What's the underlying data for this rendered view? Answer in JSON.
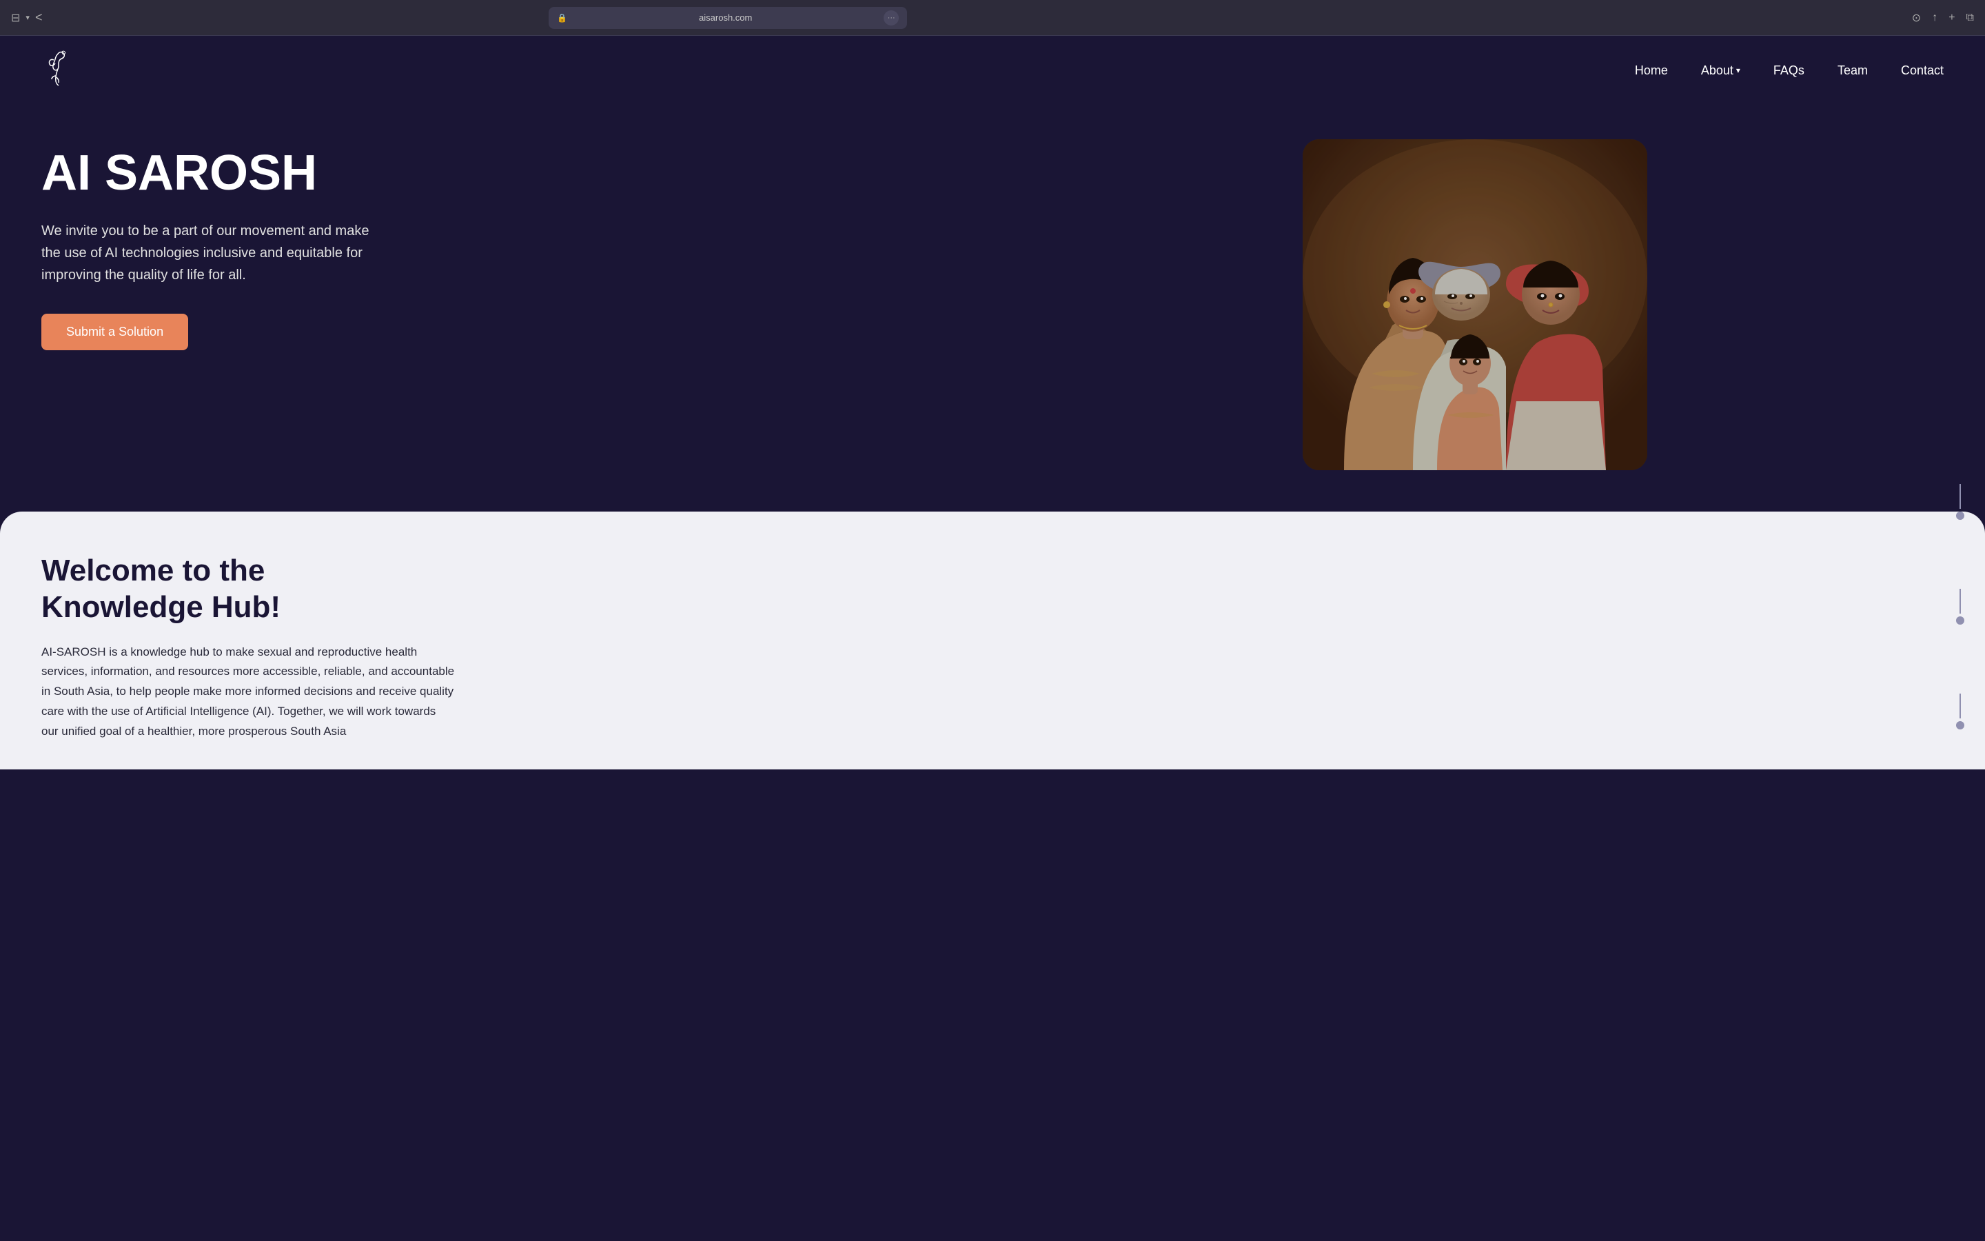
{
  "browser": {
    "url": "aisarosh.com",
    "lock_icon": "🔒",
    "dots": "···"
  },
  "navbar": {
    "logo_alt": "AI Sarosh Logo",
    "links": [
      {
        "label": "Home",
        "id": "home",
        "has_dropdown": false
      },
      {
        "label": "About",
        "id": "about",
        "has_dropdown": true
      },
      {
        "label": "FAQs",
        "id": "faqs",
        "has_dropdown": false
      },
      {
        "label": "Team",
        "id": "team",
        "has_dropdown": false
      },
      {
        "label": "Contact",
        "id": "contact",
        "has_dropdown": false
      }
    ]
  },
  "hero": {
    "title": "AI SAROSH",
    "subtitle": "We invite you to be a part of our movement and make the use of AI technologies inclusive and equitable for improving the quality of life for all.",
    "cta_button": "Submit a Solution",
    "image_alt": "Three generations of South Asian women with a child"
  },
  "knowledge_hub": {
    "title": "Welcome to the Knowledge Hub!",
    "description": "AI-SAROSH is a knowledge hub to make sexual and reproductive health services, information, and resources more accessible, reliable, and accountable in South Asia, to help people make more informed decisions and receive quality care with the use of Artificial Intelligence (AI). Together, we will work towards our unified goal of a healthier, more prosperous South Asia"
  },
  "colors": {
    "bg_dark": "#1a1535",
    "cta_orange": "#e8845a",
    "text_white": "#ffffff",
    "text_light": "#e0e0e0",
    "hub_bg": "#f0f0f5",
    "hub_dark": "#1a1535"
  }
}
